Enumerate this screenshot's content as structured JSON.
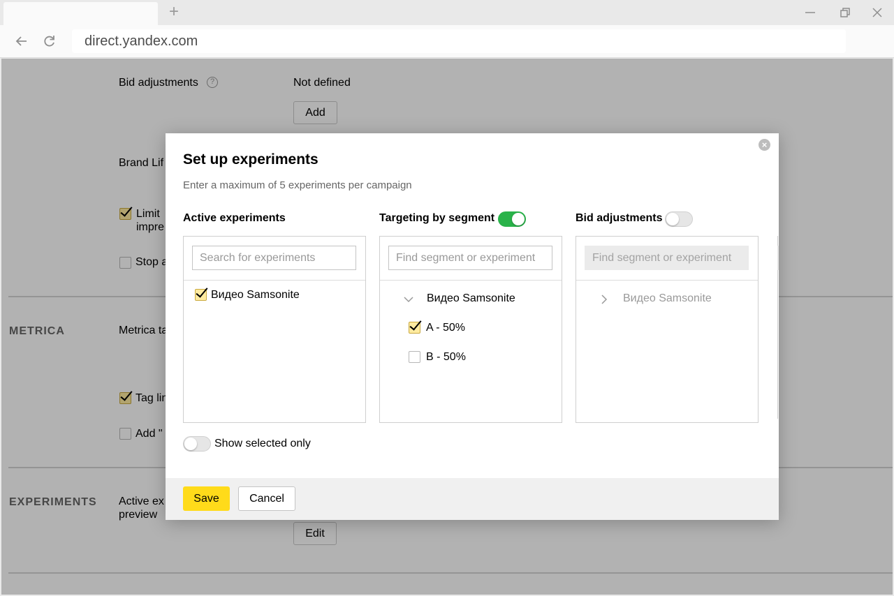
{
  "browser": {
    "url": "direct.yandex.com",
    "new_tab_symbol": "+"
  },
  "page": {
    "bid_adjustments_label": "Bid adjustments",
    "bid_adjustments_value": "Not defined",
    "add_button": "Add",
    "brand_lift_label": "Brand Lif",
    "limit_label_1": "Limit ",
    "limit_label_2": "impre",
    "stop_label": "Stop a",
    "metrica_section": "METRICA",
    "metrica_tags_label": "Metrica ta",
    "tag_links_label": "Tag lin",
    "add_utm_label": "Add \"",
    "experiments_section": "EXPERIMENTS",
    "active_exp_label_1": "Active ex",
    "active_exp_label_2": "preview",
    "edit_button": "Edit"
  },
  "modal": {
    "title": "Set up experiments",
    "subtitle": "Enter a maximum of 5 experiments per campaign",
    "close_symbol": "×",
    "columns": {
      "active": {
        "title": "Active experiments",
        "search_placeholder": "Search for experiments",
        "items": [
          {
            "label": "Видео Samsonite",
            "checked": true
          }
        ]
      },
      "targeting": {
        "title": "Targeting by segment",
        "toggle_on": true,
        "search_placeholder": "Find segment or experiment",
        "group": "Видео Samsonite",
        "options": [
          {
            "label": "A - 50%",
            "checked": true
          },
          {
            "label": "B - 50%",
            "checked": false
          }
        ]
      },
      "bids": {
        "title": "Bid adjustments",
        "toggle_on": false,
        "search_placeholder": "Find segment or experiment",
        "group": "Видео Samsonite"
      }
    },
    "show_selected_only": "Show selected only",
    "save_button": "Save",
    "cancel_button": "Cancel"
  },
  "colors": {
    "accent_yellow": "#ffdb1a",
    "toggle_green": "#2ab34a",
    "checkbox_fill": "#ffeba0"
  }
}
